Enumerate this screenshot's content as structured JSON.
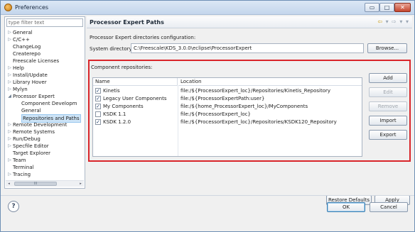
{
  "window": {
    "title": "Preferences",
    "controls": {
      "minimize": "▭",
      "maximize": "□",
      "close": "✕"
    }
  },
  "nav": {
    "filter_placeholder": "type filter text",
    "items": [
      {
        "label": "General",
        "arrow": "▷"
      },
      {
        "label": "C/C++",
        "arrow": "▷"
      },
      {
        "label": "ChangeLog",
        "arrow": ""
      },
      {
        "label": "Createrepo",
        "arrow": ""
      },
      {
        "label": "Freescale Licenses",
        "arrow": ""
      },
      {
        "label": "Help",
        "arrow": "▷"
      },
      {
        "label": "Install/Update",
        "arrow": "▷"
      },
      {
        "label": "Library Hover",
        "arrow": "▷"
      },
      {
        "label": "Mylyn",
        "arrow": "▷"
      },
      {
        "label": "Processor Expert",
        "arrow": "◢"
      },
      {
        "label": "Component Developm",
        "arrow": ""
      },
      {
        "label": "General",
        "arrow": ""
      },
      {
        "label": "Repositories and Paths",
        "arrow": ""
      },
      {
        "label": "Remote Development",
        "arrow": "▷"
      },
      {
        "label": "Remote Systems",
        "arrow": "▷"
      },
      {
        "label": "Run/Debug",
        "arrow": "▷"
      },
      {
        "label": "Specfile Editor",
        "arrow": "▷"
      },
      {
        "label": "Target Explorer",
        "arrow": ""
      },
      {
        "label": "Team",
        "arrow": "▷"
      },
      {
        "label": "Terminal",
        "arrow": ""
      },
      {
        "label": "Tracing",
        "arrow": "▷"
      }
    ],
    "scroll_left": "◂",
    "scroll_right": "▸",
    "scroll_thumb": "III"
  },
  "page": {
    "title": "Processor Expert Paths",
    "nav_arrows": {
      "back": "⇦",
      "back_menu": "▾",
      "forward": "⇨",
      "forward_menu": "▾",
      "view_menu": "▾"
    },
    "dir_config_label": "Processor Expert directories configuration:",
    "sysdir_label": "System directory",
    "sysdir_value": "C:\\Freescale\\KDS_3.0.0\\eclipse\\ProcessorExpert",
    "browse_label": "Browse...",
    "repo_label": "Component repositories:",
    "columns": {
      "name": "Name",
      "location": "Location"
    },
    "repos": [
      {
        "checked": "✓",
        "name": "Kinetis",
        "location": "file:/${ProcessorExpert_loc}/Repositories/Kinetis_Repository"
      },
      {
        "checked": "✓",
        "name": "Legacy User Components",
        "location": "file:/${ProcessorExpertPath:user}"
      },
      {
        "checked": "✓",
        "name": "My Components",
        "location": "file:/${home_ProcessorExpert_loc}/MyComponents"
      },
      {
        "checked": "",
        "name": "KSDK 1.1",
        "location": "file:/${ProcessorExpert_loc}"
      },
      {
        "checked": "✓",
        "name": "KSDK 1.2.0",
        "location": "file:/${ProcessorExpert_loc}/Repositories/KSDK120_Repository"
      }
    ],
    "buttons": {
      "add": "Add",
      "edit": "Edit",
      "remove": "Remove",
      "import": "Import",
      "export": "Export",
      "restore_defaults": "Restore Defaults",
      "apply": "Apply"
    }
  },
  "footer": {
    "help": "?",
    "ok": "OK",
    "cancel": "Cancel"
  }
}
